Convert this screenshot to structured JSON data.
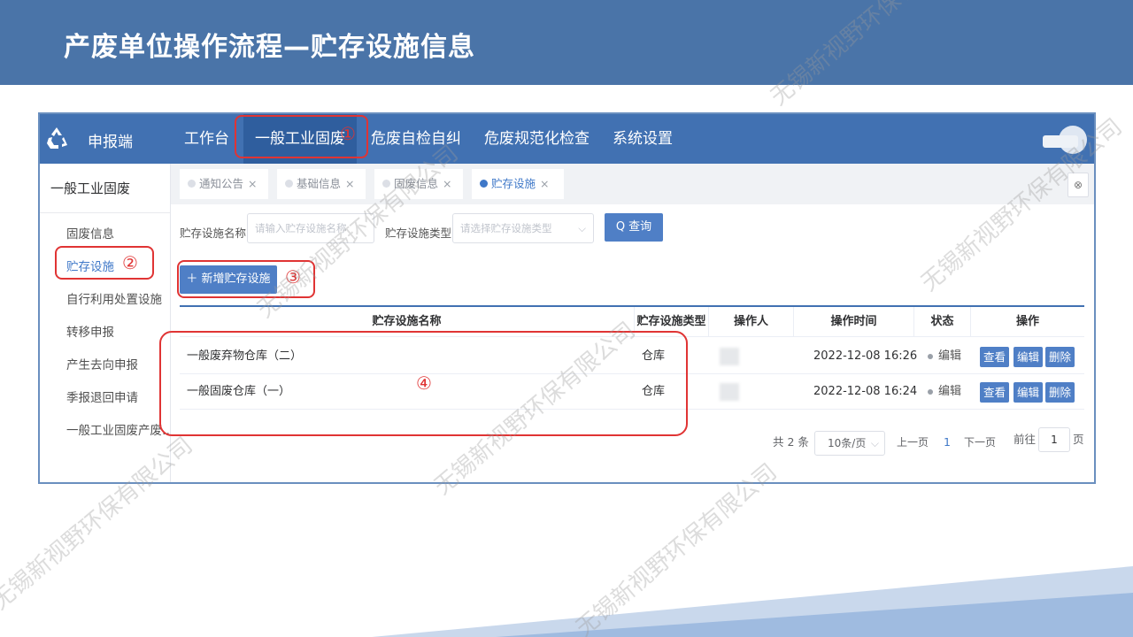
{
  "slide": {
    "title": "产废单位操作流程—贮存设施信息"
  },
  "app": {
    "name": "申报端",
    "nav": [
      "工作台",
      "一般工业固废",
      "危废自检自纠",
      "危废规范化检查",
      "系统设置"
    ],
    "active_nav": "一般工业固废"
  },
  "sidebar": {
    "title": "一般工业固废",
    "items": [
      "固废信息",
      "贮存设施",
      "自行利用处置设施",
      "转移申报",
      "产生去向申报",
      "季报退回申请",
      "一般工业固废产废…"
    ]
  },
  "tabs": [
    {
      "label": "通知公告",
      "close": "×"
    },
    {
      "label": "基础信息",
      "close": "×"
    },
    {
      "label": "固废信息",
      "close": "×"
    },
    {
      "label": "贮存设施",
      "close": "×"
    }
  ],
  "tab_close_all": "⊗",
  "search": {
    "name_label": "贮存设施名称",
    "name_placeholder": "请输入贮存设施名称",
    "type_label": "贮存设施类型",
    "type_placeholder": "请选择贮存设施类型",
    "query_button": "Q 查询"
  },
  "toolbar": {
    "add_button": "＋ 新增贮存设施"
  },
  "table": {
    "columns": [
      "贮存设施名称",
      "贮存设施类型",
      "操作人",
      "操作时间",
      "状态",
      "操作"
    ],
    "rows": [
      {
        "name": "一般废弃物仓库（二）",
        "type": "仓库",
        "time": "2022-12-08 16:26",
        "status": "编辑"
      },
      {
        "name": "一般固废仓库（一）",
        "type": "仓库",
        "time": "2022-12-08 16:24",
        "status": "编辑"
      }
    ],
    "actions": [
      "查看",
      "编辑",
      "删除"
    ]
  },
  "pagination": {
    "total": "共 2 条",
    "page_size": "10条/页",
    "prev": "上一页",
    "current": "1",
    "next": "下一页",
    "goto_label": "前往",
    "goto_value": "1",
    "goto_suffix": "页"
  },
  "annotations": [
    "①",
    "②",
    "③",
    "④"
  ],
  "watermark": "无锡新视野环保有限公司",
  "colors": {
    "header": "#4a74a8",
    "topbar": "#4171b2",
    "accent": "#4f7fc6",
    "annotation": "#e03434"
  }
}
